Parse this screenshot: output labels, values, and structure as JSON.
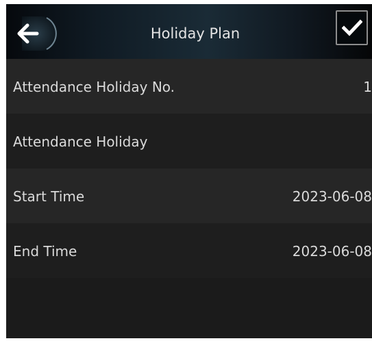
{
  "header": {
    "title": "Holiday Plan",
    "back_icon": "arrow-left-icon",
    "confirm_icon": "checkmark-icon"
  },
  "fields": [
    {
      "label": "Attendance Holiday No.",
      "value": "1"
    },
    {
      "label": "Attendance Holiday",
      "value": ""
    },
    {
      "label": "Start Time",
      "value": "2023-06-08"
    },
    {
      "label": "End Time",
      "value": "2023-06-08"
    }
  ],
  "colors": {
    "header_bg": "#1a2b36",
    "row_light": "#262626",
    "row_dark": "#1e1e1e",
    "text": "#dadada"
  }
}
